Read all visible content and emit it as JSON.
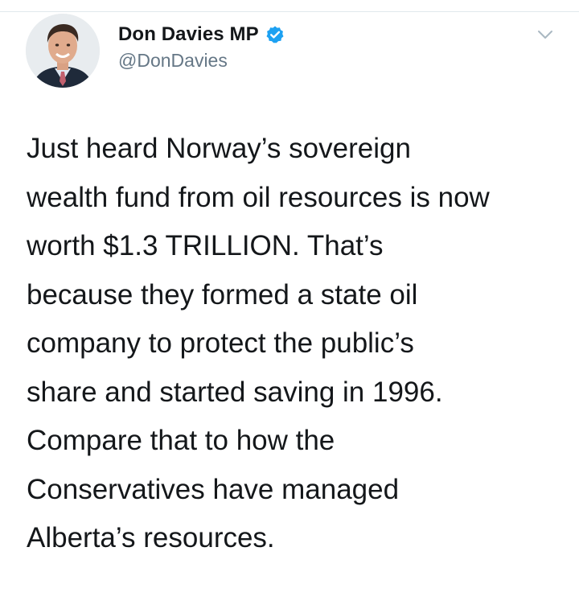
{
  "tweet": {
    "author": {
      "display_name": "Don Davies MP",
      "handle": "@DonDavies",
      "verified": true
    },
    "text_lines": [
      "Just heard Norway’s sovereign",
      "wealth fund from oil resources is now",
      "worth $1.3 TRILLION.  That’s",
      "because they formed a state oil",
      "company to protect the public’s",
      "share and started saving in 1996.",
      "Compare that to how the",
      "Conservatives have managed",
      "Alberta’s resources."
    ]
  },
  "icons": {
    "verified": "verified-badge-icon",
    "menu": "chevron-down-icon"
  },
  "colors": {
    "text": "#14171a",
    "secondary_text": "#657786",
    "verified_blue": "#1da1f2",
    "divider": "#e1e8ed"
  }
}
